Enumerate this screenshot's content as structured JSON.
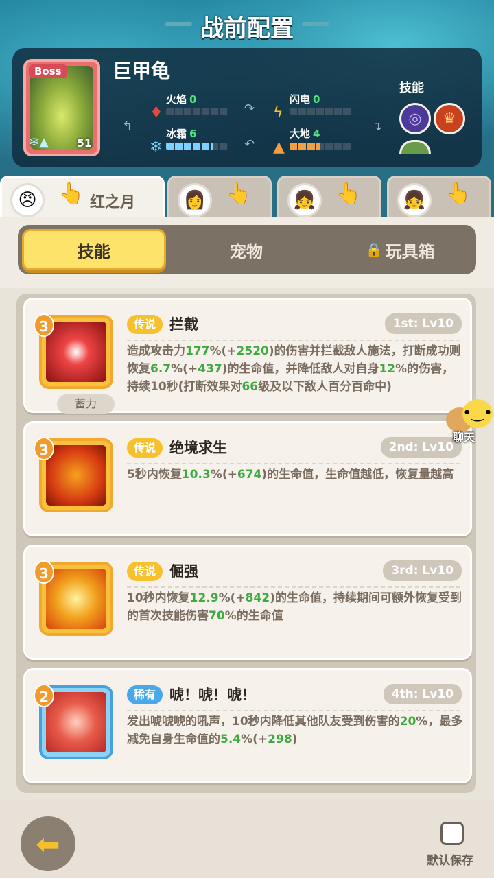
{
  "header": {
    "title": "战前配置"
  },
  "boss": {
    "tag": "Boss",
    "name": "巨甲龟",
    "level": "51",
    "stats": [
      {
        "label": "火焰",
        "value": "0",
        "level": 0,
        "max": 8
      },
      {
        "label": "闪电",
        "value": "0",
        "level": 0,
        "max": 8
      },
      {
        "label": "冰霜",
        "value": "6",
        "level": 6,
        "max": 8
      },
      {
        "label": "大地",
        "value": "4",
        "level": 4,
        "max": 8
      }
    ],
    "skills_label": "技能"
  },
  "char_tabs": [
    {
      "name": "红之月",
      "active": true
    },
    {
      "name": "",
      "active": false
    },
    {
      "name": "",
      "active": false
    },
    {
      "name": "",
      "active": false
    }
  ],
  "sub_tabs": [
    {
      "label": "技能",
      "active": true
    },
    {
      "label": "宠物",
      "active": false
    },
    {
      "label": "玩具箱",
      "active": false,
      "locked": true
    }
  ],
  "skills": [
    {
      "rank": "3",
      "rarity": "传说",
      "name": "拦截",
      "level_tag": "1st: Lv10",
      "charge": "蓄力",
      "desc_parts": [
        [
          "造成攻击力",
          ""
        ],
        [
          "177",
          "g"
        ],
        [
          "%(+",
          ""
        ],
        [
          "2520",
          "g"
        ],
        [
          ")的伤害并拦截敌人施法，打断成功则恢复",
          ""
        ],
        [
          "6.7",
          "g"
        ],
        [
          "%(+",
          ""
        ],
        [
          "437",
          "g"
        ],
        [
          ")的生命值，并降低敌人对自身",
          ""
        ],
        [
          "12",
          "g"
        ],
        [
          "%的伤害，持续10秒(打断效果对",
          ""
        ],
        [
          "66",
          "g"
        ],
        [
          "级及以下敌人百分百命中)",
          ""
        ]
      ]
    },
    {
      "rank": "3",
      "rarity": "传说",
      "name": "绝境求生",
      "level_tag": "2nd: Lv10",
      "desc_parts": [
        [
          "5秒内恢复",
          ""
        ],
        [
          "10.3",
          "g"
        ],
        [
          "%(+",
          ""
        ],
        [
          "674",
          "g"
        ],
        [
          ")的生命值，生命值越低，恢复量越高",
          ""
        ]
      ]
    },
    {
      "rank": "3",
      "rarity": "传说",
      "name": "倔强",
      "level_tag": "3rd: Lv10",
      "desc_parts": [
        [
          "10秒内恢复",
          ""
        ],
        [
          "12.9",
          "g"
        ],
        [
          "%(+",
          ""
        ],
        [
          "842",
          "g"
        ],
        [
          ")的生命值，持续期间可额外恢复受到的首次技能伤害",
          ""
        ],
        [
          "70",
          "g"
        ],
        [
          "%的生命值",
          ""
        ]
      ]
    },
    {
      "rank": "2",
      "rarity": "稀有",
      "name": "唬！唬！唬！",
      "level_tag": "4th: Lv10",
      "desc_parts": [
        [
          "发出唬唬唬的吼声，10秒内降低其他队友受到伤害的",
          ""
        ],
        [
          "20",
          "g"
        ],
        [
          "%，最多减免自身生命值的",
          ""
        ],
        [
          "5.4",
          "g"
        ],
        [
          "%(+",
          ""
        ],
        [
          "298",
          "g"
        ],
        [
          ")",
          ""
        ]
      ]
    }
  ],
  "chat_label": "聊天",
  "save_label": "默认保存",
  "colors": {
    "legend": "#f6c12d",
    "rare": "#4aa8ea",
    "green_value": "#3caa3f",
    "active_tab": "#fde36a"
  }
}
